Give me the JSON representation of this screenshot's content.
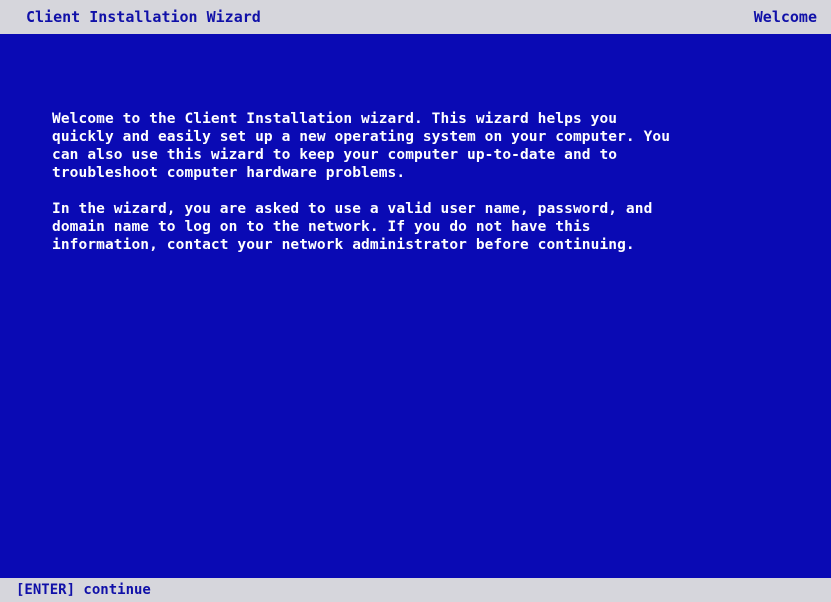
{
  "header": {
    "title": "Client Installation Wizard",
    "section": "Welcome"
  },
  "main": {
    "paragraphs": [
      {
        "lines": [
          "Welcome to the Client Installation wizard. This wizard helps you",
          "quickly and easily set up a new operating system on your computer. You",
          "can also use this wizard to keep your computer up-to-date and to",
          "troubleshoot computer hardware problems."
        ]
      },
      {
        "lines": [
          "In the wizard, you are asked to use a valid user name, password, and",
          "domain name to log on to the network. If you do not have this",
          "information, contact your network administrator before continuing."
        ]
      }
    ]
  },
  "footer": {
    "hint": "[ENTER] continue"
  }
}
